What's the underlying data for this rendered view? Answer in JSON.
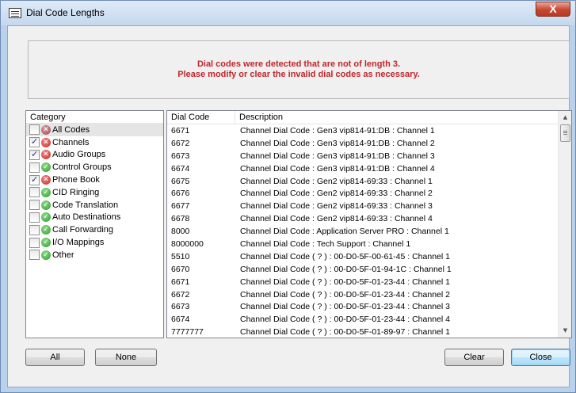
{
  "window": {
    "title": "Dial Code Lengths",
    "close_glyph": "X"
  },
  "banner": {
    "line1": "Dial codes were detected that are not of length 3.",
    "line2": "Please modify or clear the invalid dial codes as necessary.",
    "color": "#c0262c"
  },
  "category": {
    "header": "Category",
    "items": [
      {
        "label": "All Codes",
        "checked": false,
        "status": "error-partial",
        "selected": true
      },
      {
        "label": "Channels",
        "checked": true,
        "status": "error"
      },
      {
        "label": "Audio Groups",
        "checked": true,
        "status": "error"
      },
      {
        "label": "Control Groups",
        "checked": false,
        "status": "ok"
      },
      {
        "label": "Phone Book",
        "checked": true,
        "status": "error"
      },
      {
        "label": "CID Ringing",
        "checked": false,
        "status": "ok"
      },
      {
        "label": "Code Translation",
        "checked": false,
        "status": "ok"
      },
      {
        "label": "Auto Destinations",
        "checked": false,
        "status": "ok"
      },
      {
        "label": "Call Forwarding",
        "checked": false,
        "status": "ok"
      },
      {
        "label": "I/O Mappings",
        "checked": false,
        "status": "ok"
      },
      {
        "label": "Other",
        "checked": false,
        "status": "ok"
      }
    ]
  },
  "grid": {
    "headers": {
      "code": "Dial Code",
      "description": "Description"
    },
    "rows": [
      {
        "code": "6671",
        "description": "Channel Dial Code : Gen3 vip814-91:DB : Channel 1"
      },
      {
        "code": "6672",
        "description": "Channel Dial Code : Gen3 vip814-91:DB : Channel 2"
      },
      {
        "code": "6673",
        "description": "Channel Dial Code : Gen3 vip814-91:DB : Channel 3"
      },
      {
        "code": "6674",
        "description": "Channel Dial Code : Gen3 vip814-91:DB : Channel 4"
      },
      {
        "code": "6675",
        "description": "Channel Dial Code : Gen2 vip814-69:33 : Channel 1"
      },
      {
        "code": "6676",
        "description": "Channel Dial Code : Gen2 vip814-69:33 : Channel 2"
      },
      {
        "code": "6677",
        "description": "Channel Dial Code : Gen2 vip814-69:33 : Channel 3"
      },
      {
        "code": "6678",
        "description": "Channel Dial Code : Gen2 vip814-69:33 : Channel 4"
      },
      {
        "code": "8000",
        "description": "Channel Dial Code : Application Server PRO : Channel 1"
      },
      {
        "code": "8000000",
        "description": "Channel Dial Code : Tech Support : Channel 1"
      },
      {
        "code": "5510",
        "description": "Channel Dial Code ( ? ) : 00-D0-5F-00-61-45 : Channel 1"
      },
      {
        "code": "6670",
        "description": "Channel Dial Code ( ? ) : 00-D0-5F-01-94-1C : Channel 1"
      },
      {
        "code": "6671",
        "description": "Channel Dial Code ( ? ) : 00-D0-5F-01-23-44 : Channel 1"
      },
      {
        "code": "6672",
        "description": "Channel Dial Code ( ? ) : 00-D0-5F-01-23-44 : Channel 2"
      },
      {
        "code": "6673",
        "description": "Channel Dial Code ( ? ) : 00-D0-5F-01-23-44 : Channel 3"
      },
      {
        "code": "6674",
        "description": "Channel Dial Code ( ? ) : 00-D0-5F-01-23-44 : Channel 4"
      },
      {
        "code": "7777777",
        "description": "Channel Dial Code ( ? ) : 00-D0-5F-01-89-97 : Channel 1"
      }
    ]
  },
  "buttons": {
    "all": "All",
    "none": "None",
    "clear": "Clear",
    "close": "Close"
  },
  "icons": {
    "error": "error-x-icon",
    "ok": "ok-check-icon",
    "scroll_up": "scroll-up-arrow-icon",
    "scroll_down": "scroll-down-arrow-icon"
  }
}
